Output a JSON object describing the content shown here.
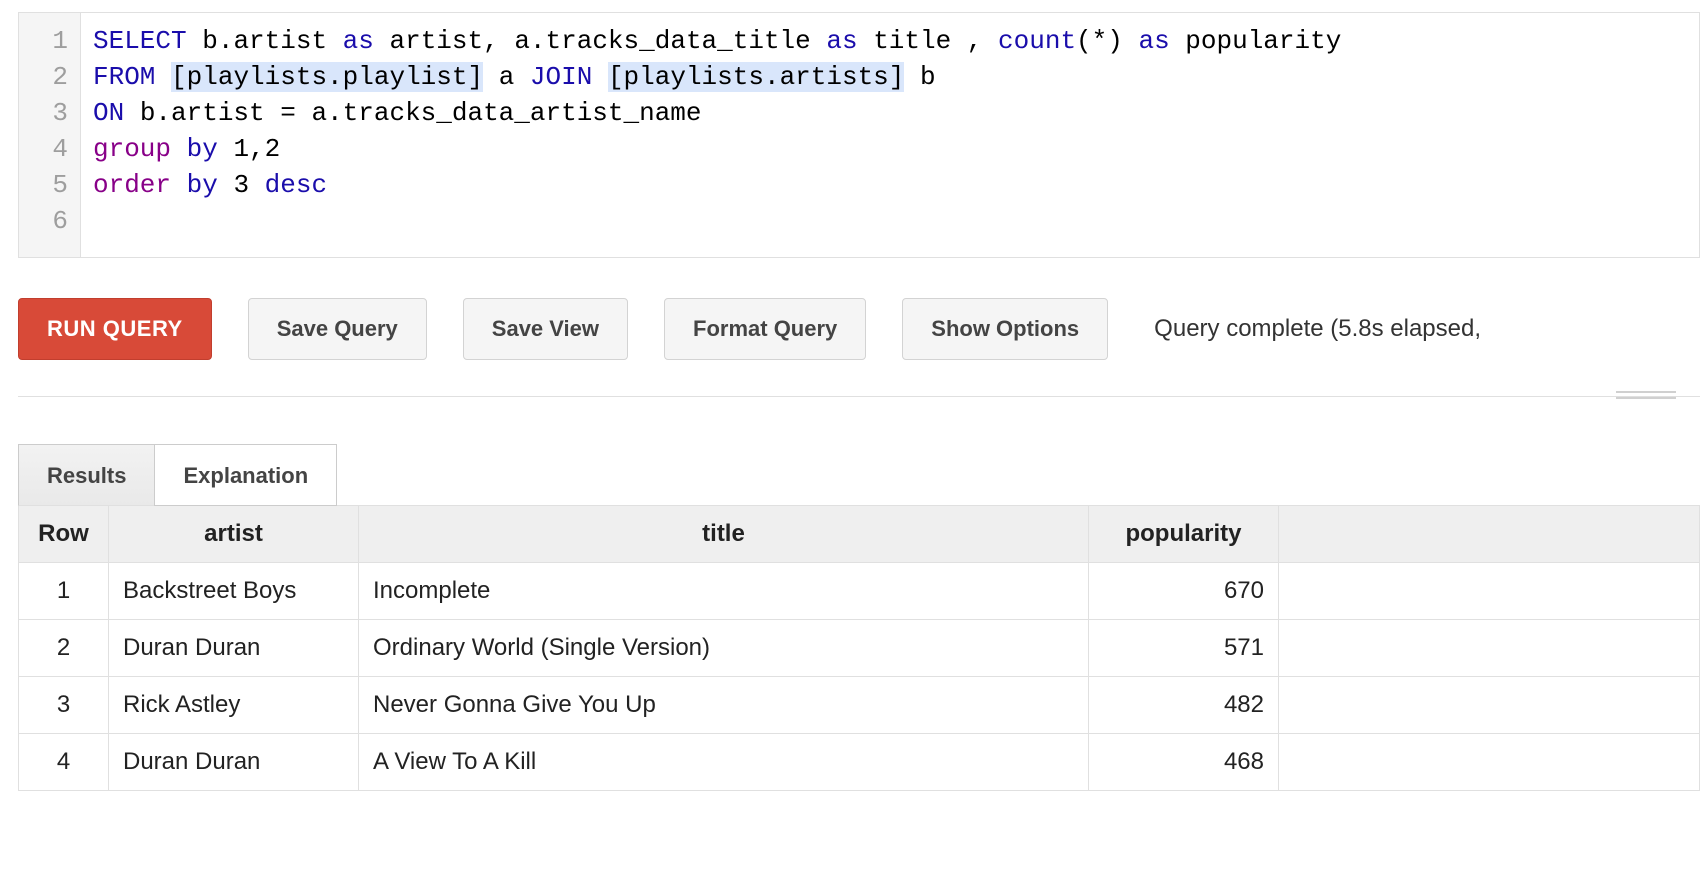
{
  "editor": {
    "line_numbers": [
      "1",
      "2",
      "3",
      "4",
      "5",
      "6"
    ],
    "tokens": [
      [
        {
          "t": "SELECT",
          "c": "kw"
        },
        {
          "t": " "
        },
        {
          "t": "b.artist "
        },
        {
          "t": "as",
          "c": "kw"
        },
        {
          "t": " artist, a.tracks_data_title "
        },
        {
          "t": "as",
          "c": "kw"
        },
        {
          "t": " title , "
        },
        {
          "t": "count",
          "c": "kw"
        },
        {
          "t": "(*) "
        },
        {
          "t": "as",
          "c": "kw"
        },
        {
          "t": " popularity"
        }
      ],
      [
        {
          "t": "FROM",
          "c": "kw"
        },
        {
          "t": " "
        },
        {
          "t": "[playlists.playlist]",
          "c": "tbl"
        },
        {
          "t": " a "
        },
        {
          "t": "JOIN",
          "c": "kw"
        },
        {
          "t": " "
        },
        {
          "t": "[playlists.artists]",
          "c": "tbl"
        },
        {
          "t": " b"
        }
      ],
      [
        {
          "t": "ON",
          "c": "kw"
        },
        {
          "t": " b.artist = a.tracks_data_artist_name"
        }
      ],
      [
        {
          "t": "group",
          "c": "kw2"
        },
        {
          "t": " "
        },
        {
          "t": "by",
          "c": "kw"
        },
        {
          "t": " 1,2"
        }
      ],
      [
        {
          "t": "order",
          "c": "kw2"
        },
        {
          "t": " "
        },
        {
          "t": "by",
          "c": "kw"
        },
        {
          "t": " 3 "
        },
        {
          "t": "desc",
          "c": "kw"
        }
      ],
      [
        {
          "t": ""
        }
      ]
    ]
  },
  "toolbar": {
    "run_label": "RUN QUERY",
    "save_query_label": "Save Query",
    "save_view_label": "Save View",
    "format_query_label": "Format Query",
    "show_options_label": "Show Options",
    "status_text": "Query complete (5.8s elapsed, "
  },
  "tabs": {
    "results_label": "Results",
    "explanation_label": "Explanation"
  },
  "table": {
    "columns": [
      "Row",
      "artist",
      "title",
      "popularity"
    ],
    "rows": [
      {
        "row": "1",
        "artist": "Backstreet Boys",
        "title": "Incomplete",
        "popularity": "670"
      },
      {
        "row": "2",
        "artist": "Duran Duran",
        "title": "Ordinary World (Single Version)",
        "popularity": "571"
      },
      {
        "row": "3",
        "artist": "Rick Astley",
        "title": "Never Gonna Give You Up",
        "popularity": "482"
      },
      {
        "row": "4",
        "artist": "Duran Duran",
        "title": "A View To A Kill",
        "popularity": "468"
      }
    ]
  }
}
